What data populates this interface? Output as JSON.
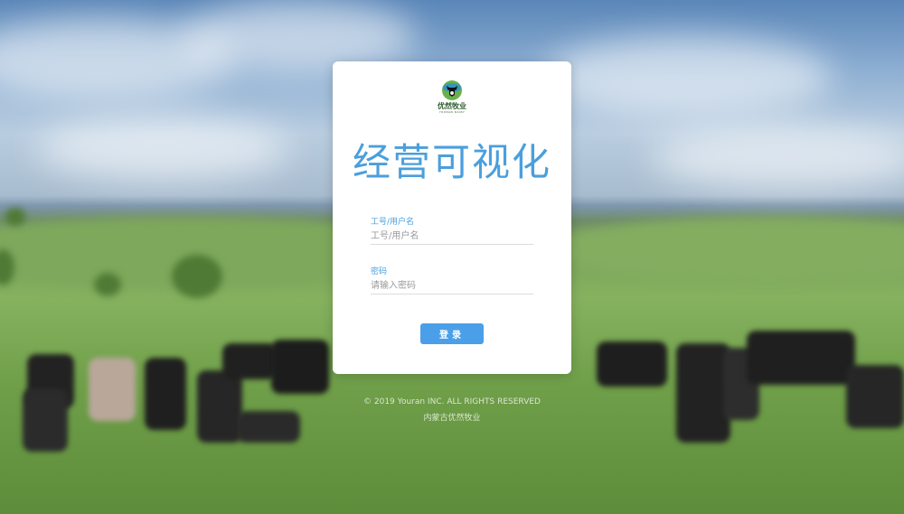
{
  "logo": {
    "icon": "cow-head-icon",
    "name": "优然牧业",
    "sub": "YOURAN DAIRY"
  },
  "app_title": "经营可视化",
  "form": {
    "username_label": "工号/用户名",
    "username_placeholder": "工号/用户名",
    "password_label": "密码",
    "password_placeholder": "请输入密码",
    "login_label": "登录"
  },
  "footer": {
    "copyright": "© 2019 Youran INC. ALL RIGHTS RESERVED",
    "owner": "内蒙古优然牧业"
  },
  "colors": {
    "accent": "#4a9fdd",
    "button": "#4a9fe8"
  }
}
